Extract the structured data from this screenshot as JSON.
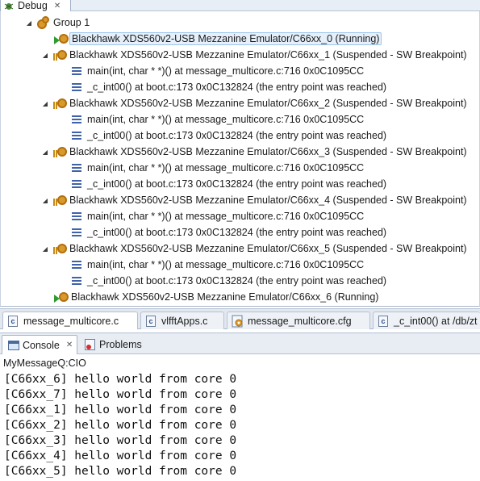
{
  "debug_view": {
    "tab_label": "Debug",
    "group_label": "Group 1",
    "items": [
      {
        "label": "Blackhawk XDS560v2-USB Mezzanine Emulator/C66xx_0 (Running)",
        "state": "running"
      },
      {
        "label": "Blackhawk XDS560v2-USB Mezzanine Emulator/C66xx_1 (Suspended - SW Breakpoint)",
        "state": "suspended"
      },
      {
        "label": "main(int, char * *)() at message_multicore.c:716 0x0C1095CC",
        "state": "frame"
      },
      {
        "label": "_c_int00() at boot.c:173 0x0C132824  (the entry point was reached)",
        "state": "frame"
      },
      {
        "label": "Blackhawk XDS560v2-USB Mezzanine Emulator/C66xx_2 (Suspended - SW Breakpoint)",
        "state": "suspended"
      },
      {
        "label": "main(int, char * *)() at message_multicore.c:716 0x0C1095CC",
        "state": "frame"
      },
      {
        "label": "_c_int00() at boot.c:173 0x0C132824  (the entry point was reached)",
        "state": "frame"
      },
      {
        "label": "Blackhawk XDS560v2-USB Mezzanine Emulator/C66xx_3 (Suspended - SW Breakpoint)",
        "state": "suspended"
      },
      {
        "label": "main(int, char * *)() at message_multicore.c:716 0x0C1095CC",
        "state": "frame"
      },
      {
        "label": "_c_int00() at boot.c:173 0x0C132824  (the entry point was reached)",
        "state": "frame"
      },
      {
        "label": "Blackhawk XDS560v2-USB Mezzanine Emulator/C66xx_4 (Suspended - SW Breakpoint)",
        "state": "suspended"
      },
      {
        "label": "main(int, char * *)() at message_multicore.c:716 0x0C1095CC",
        "state": "frame"
      },
      {
        "label": "_c_int00() at boot.c:173 0x0C132824  (the entry point was reached)",
        "state": "frame"
      },
      {
        "label": "Blackhawk XDS560v2-USB Mezzanine Emulator/C66xx_5 (Suspended - SW Breakpoint)",
        "state": "suspended"
      },
      {
        "label": "main(int, char * *)() at message_multicore.c:716 0x0C1095CC",
        "state": "frame"
      },
      {
        "label": "_c_int00() at boot.c:173 0x0C132824  (the entry point was reached)",
        "state": "frame"
      },
      {
        "label": "Blackhawk XDS560v2-USB Mezzanine Emulator/C66xx_6 (Running)",
        "state": "running"
      }
    ]
  },
  "editor_tabs": [
    {
      "label": "message_multicore.c",
      "icon": "c-file-icon"
    },
    {
      "label": "vlfftApps.c",
      "icon": "c-file-icon"
    },
    {
      "label": "message_multicore.cfg",
      "icon": "cfg-file-icon"
    },
    {
      "label": "_c_int00() at /db/zt",
      "icon": "c-file-icon"
    }
  ],
  "console_view": {
    "tabs": [
      {
        "label": "Console",
        "icon": "console-icon"
      },
      {
        "label": "Problems",
        "icon": "problems-icon"
      }
    ],
    "title": "MyMessageQ:CIO",
    "lines": [
      "[C66xx_6] hello world from core 0",
      "[C66xx_7] hello world from core 0",
      "[C66xx_1] hello world from core 0",
      "[C66xx_2] hello world from core 0",
      "[C66xx_3] hello world from core 0",
      "[C66xx_4] hello world from core 0",
      "[C66xx_5] hello world from core 0"
    ]
  },
  "colors": {
    "accent": "#9cc4ea",
    "running": "#2f9a2f",
    "suspended": "#c78a12",
    "frame": "#3f63a8"
  }
}
